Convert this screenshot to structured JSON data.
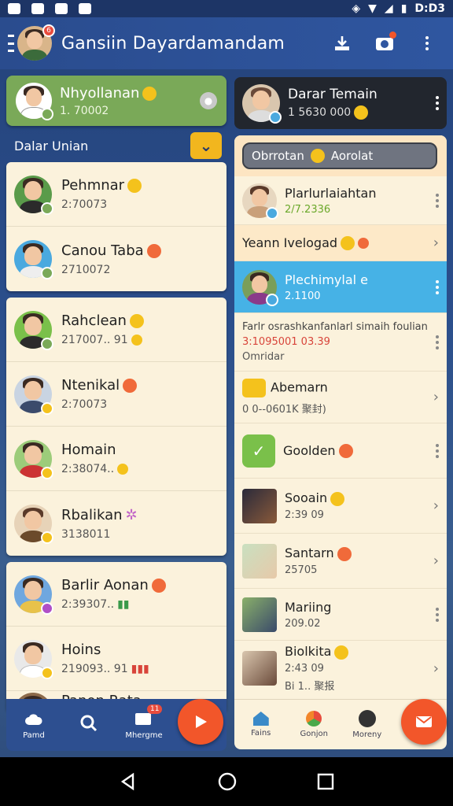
{
  "status_bar": {
    "time": "D:D3"
  },
  "app_bar": {
    "title": "Gansiin Dayardamandam",
    "avatar_badge": "6"
  },
  "left": {
    "highlight": {
      "name": "Nhyollanan",
      "sub": "1. 70002"
    },
    "section_title": "Dalar Unian",
    "groups": [
      [
        {
          "name": "Pehmnar",
          "sub": "2:70073"
        },
        {
          "name": "Canou Taba",
          "sub": "2710072"
        }
      ],
      [
        {
          "name": "Rahclean",
          "sub": "217007.. 91"
        },
        {
          "name": "Ntenikal",
          "sub": "2:70073"
        },
        {
          "name": "Homain",
          "sub": "2:38074.."
        },
        {
          "name": "Rbalikan",
          "sub": "3138011"
        }
      ],
      [
        {
          "name": "Barlir Aonan",
          "sub": "2:39307.."
        },
        {
          "name": "Hoins",
          "sub": "219093.. 91"
        },
        {
          "name": "Panon Rata",
          "sub": ""
        }
      ]
    ],
    "tabs": [
      {
        "label": "Pamd"
      },
      {
        "label": ""
      },
      {
        "label": "Mhergme",
        "badge": "11"
      }
    ]
  },
  "right": {
    "dark_card": {
      "name": "Darar Temain",
      "sub": "1 5630 000"
    },
    "search_placeholder": "Obrrotan",
    "search_suffix": "Aorolat",
    "rows": [
      {
        "name": "Plarlurlaiahtan",
        "sub": "2/7.2336"
      },
      {
        "name": "Yeann Ivelogad"
      },
      {
        "name": "Plechimylal e",
        "sub": "2.1100"
      },
      {
        "name": "Farlr osrashkanfanlarl simaih foulian",
        "sub": "3:1095001 03.39",
        "sub2": "Omridar"
      },
      {
        "name": "Abemarn",
        "sub": "0 0--0601K 聚封)"
      },
      {
        "name": "Goolden"
      },
      {
        "name": "Sooain",
        "sub": "2:39 09"
      },
      {
        "name": "Santarn",
        "sub": "25705"
      },
      {
        "name": "Mariing",
        "sub": "209.02"
      },
      {
        "name": "Biolkita",
        "sub": "2:43 09",
        "sub2": "Bi 1.. 聚报"
      }
    ],
    "tabs": [
      {
        "label": "Fains"
      },
      {
        "label": "Gonjon"
      },
      {
        "label": "Moreny"
      }
    ]
  },
  "colors": {
    "accent": "#f2562a",
    "appbar": "#2f56a0",
    "highlight": "#7aa958",
    "selected": "#46b2e6",
    "card": "#fbf2dc"
  }
}
